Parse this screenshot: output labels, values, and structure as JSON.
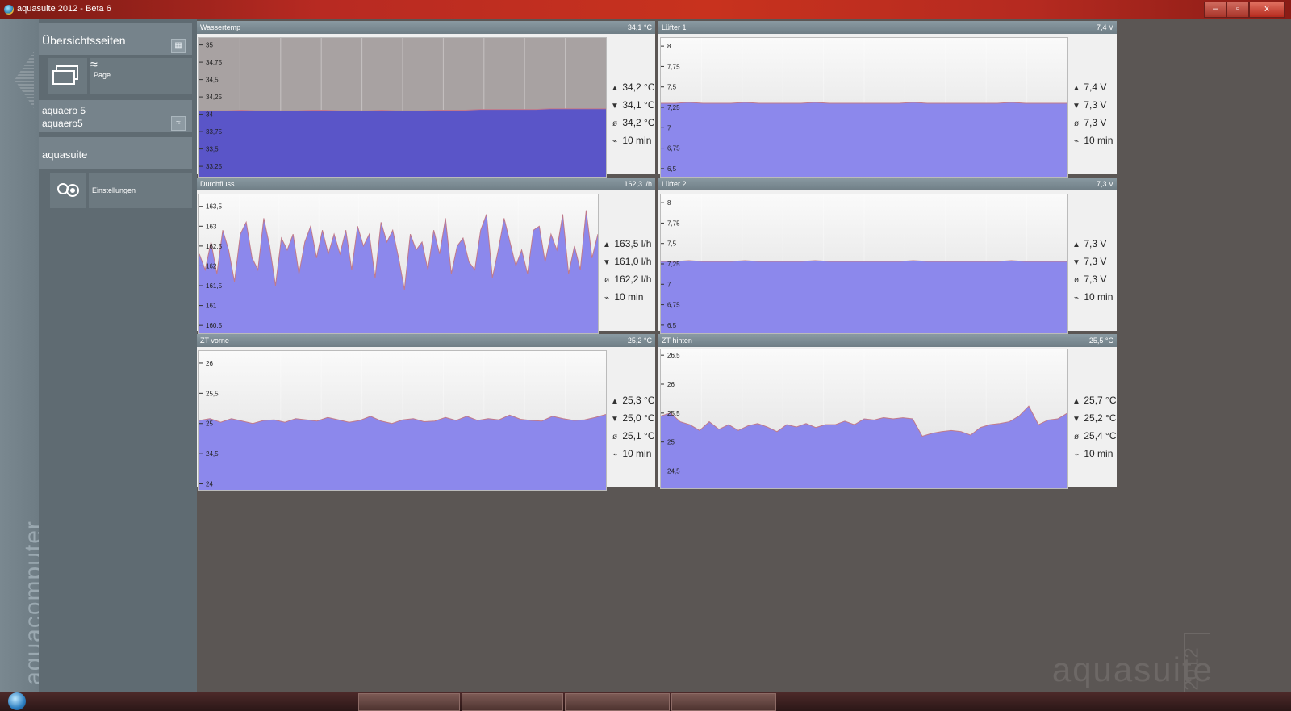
{
  "window": {
    "title": "aquasuite 2012 - Beta 6",
    "controls": {
      "minimize": "–",
      "maximize": "▫",
      "close": "x"
    }
  },
  "sidebar": {
    "overview_label": "Übersichtsseiten",
    "page_label": "Page",
    "device_line1": "aquaero 5",
    "device_line2": "aquaero5",
    "aquasuite_label": "aquasuite",
    "settings_label": "Einstellungen",
    "brand_vertical": "aquacomputer"
  },
  "watermark": {
    "text": "aquasuite",
    "year": "2012"
  },
  "panels": [
    {
      "title": "Wassertemp",
      "value": "34,1 °C",
      "max": "34,2 °C",
      "min": "34,1 °C",
      "avg": "34,2 °C",
      "range": "10 min"
    },
    {
      "title": "Lüfter 1",
      "value": "7,4 V",
      "max": "7,4 V",
      "min": "7,3 V",
      "avg": "7,3 V",
      "range": "10 min"
    },
    {
      "title": "Durchfluss",
      "value": "162,3 l/h",
      "max": "163,5 l/h",
      "min": "161,0 l/h",
      "avg": "162,2 l/h",
      "range": "10 min"
    },
    {
      "title": "Lüfter 2",
      "value": "7,3 V",
      "max": "7,3 V",
      "min": "7,3 V",
      "avg": "7,3 V",
      "range": "10 min"
    },
    {
      "title": "ZT vorne",
      "value": "25,2 °C",
      "max": "25,3 °C",
      "min": "25,0 °C",
      "avg": "25,1 °C",
      "range": "10 min"
    },
    {
      "title": "ZT hinten",
      "value": "25,5 °C",
      "max": "25,7 °C",
      "min": "25,2 °C",
      "avg": "25,4 °C",
      "range": "10 min"
    }
  ],
  "chart_data": [
    {
      "type": "area",
      "ylim": [
        33.1,
        35.1
      ],
      "ticks": [
        "35",
        "34,75",
        "34,5",
        "34,25",
        "34",
        "33,75",
        "33,5",
        "33,25"
      ],
      "tick_values": [
        35,
        34.75,
        34.5,
        34.25,
        34,
        33.75,
        33.5,
        33.25
      ],
      "values": [
        34.05,
        34.05,
        34.05,
        34.06,
        34.05,
        34.05,
        34.05,
        34.05,
        34.06,
        34.06,
        34.05,
        34.05,
        34.05,
        34.06,
        34.05,
        34.05,
        34.05,
        34.06,
        34.06,
        34.06,
        34.07,
        34.07,
        34.07,
        34.07,
        34.07,
        34.08,
        34.08,
        34.08,
        34.08,
        34.08
      ]
    },
    {
      "type": "area",
      "ylim": [
        6.4,
        8.1
      ],
      "ticks": [
        "8",
        "7,75",
        "7,5",
        "7,25",
        "7",
        "6,75",
        "6,5"
      ],
      "tick_values": [
        8,
        7.75,
        7.5,
        7.25,
        7,
        6.75,
        6.5
      ],
      "values": [
        7.3,
        7.3,
        7.31,
        7.3,
        7.3,
        7.3,
        7.31,
        7.3,
        7.3,
        7.3,
        7.3,
        7.31,
        7.3,
        7.3,
        7.3,
        7.3,
        7.3,
        7.3,
        7.31,
        7.3,
        7.3,
        7.3,
        7.3,
        7.3,
        7.3,
        7.31,
        7.3,
        7.3,
        7.3,
        7.3
      ]
    },
    {
      "type": "area",
      "ylim": [
        160.3,
        163.8
      ],
      "ticks": [
        "163,5",
        "163",
        "162,5",
        "162",
        "161,5",
        "161",
        "160,5"
      ],
      "tick_values": [
        163.5,
        163,
        162.5,
        162,
        161.5,
        161,
        160.5
      ],
      "values": [
        162.3,
        161.9,
        162.6,
        161.8,
        162.9,
        162.4,
        161.6,
        162.8,
        163.1,
        162.2,
        161.9,
        163.2,
        162.5,
        161.5,
        162.7,
        162.4,
        162.8,
        161.8,
        162.6,
        163.0,
        162.2,
        162.9,
        162.3,
        162.8,
        162.3,
        162.9,
        161.9,
        163.0,
        162.5,
        162.8,
        161.7,
        163.1,
        162.6,
        162.9,
        162.2,
        161.4,
        162.8,
        162.4,
        162.6,
        161.9,
        162.9,
        162.3,
        163.2,
        161.8,
        162.5,
        162.7,
        162.1,
        161.9,
        162.9,
        163.3,
        161.7,
        162.4,
        163.2,
        162.6,
        162.0,
        162.4,
        161.8,
        162.9,
        163.0,
        162.1,
        162.8,
        162.4,
        163.3,
        161.8,
        162.5,
        161.9,
        163.4,
        162.2,
        162.8
      ]
    },
    {
      "type": "area",
      "ylim": [
        6.4,
        8.1
      ],
      "ticks": [
        "8",
        "7,75",
        "7,5",
        "7,25",
        "7",
        "6,75",
        "6,5"
      ],
      "tick_values": [
        8,
        7.75,
        7.5,
        7.25,
        7,
        6.75,
        6.5
      ],
      "values": [
        7.28,
        7.28,
        7.29,
        7.28,
        7.28,
        7.28,
        7.29,
        7.28,
        7.28,
        7.28,
        7.28,
        7.29,
        7.28,
        7.28,
        7.28,
        7.28,
        7.28,
        7.28,
        7.29,
        7.28,
        7.28,
        7.28,
        7.28,
        7.28,
        7.28,
        7.29,
        7.28,
        7.28,
        7.28,
        7.28
      ]
    },
    {
      "type": "area",
      "ylim": [
        23.9,
        26.2
      ],
      "ticks": [
        "26",
        "25,5",
        "25",
        "24,5",
        "24"
      ],
      "tick_values": [
        26,
        25.5,
        25,
        24.5,
        24
      ],
      "values": [
        25.05,
        25.08,
        25.02,
        25.08,
        25.04,
        25.0,
        25.05,
        25.06,
        25.02,
        25.08,
        25.06,
        25.04,
        25.1,
        25.06,
        25.02,
        25.05,
        25.12,
        25.04,
        25.0,
        25.06,
        25.08,
        25.03,
        25.04,
        25.1,
        25.05,
        25.12,
        25.05,
        25.08,
        25.06,
        25.14,
        25.07,
        25.05,
        25.04,
        25.12,
        25.08,
        25.05,
        25.06,
        25.1,
        25.15
      ]
    },
    {
      "type": "area",
      "ylim": [
        24.2,
        26.6
      ],
      "ticks": [
        "26,5",
        "26",
        "25,5",
        "25",
        "24,5"
      ],
      "tick_values": [
        26.5,
        26,
        25.5,
        25,
        24.5
      ],
      "values": [
        25.45,
        25.5,
        25.35,
        25.3,
        25.2,
        25.35,
        25.22,
        25.3,
        25.2,
        25.28,
        25.32,
        25.26,
        25.18,
        25.3,
        25.26,
        25.32,
        25.25,
        25.3,
        25.3,
        25.36,
        25.3,
        25.4,
        25.38,
        25.42,
        25.4,
        25.42,
        25.4,
        25.1,
        25.15,
        25.18,
        25.2,
        25.18,
        25.12,
        25.25,
        25.3,
        25.32,
        25.35,
        25.45,
        25.62,
        25.3,
        25.38,
        25.4,
        25.5
      ]
    }
  ]
}
